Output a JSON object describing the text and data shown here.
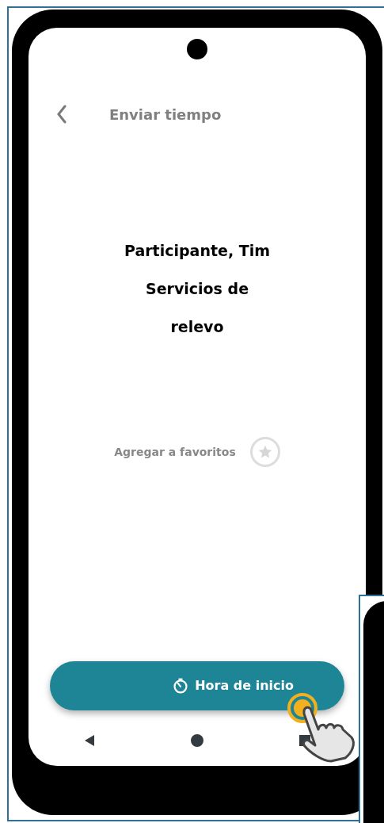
{
  "header": {
    "title": "Enviar tiempo"
  },
  "participant": {
    "lines": [
      "Participante, Tim",
      "Servicios de",
      "relevo"
    ]
  },
  "favorite": {
    "label": "Agregar a favoritos",
    "starred": false
  },
  "start_button": {
    "label": "Hora de inicio"
  }
}
